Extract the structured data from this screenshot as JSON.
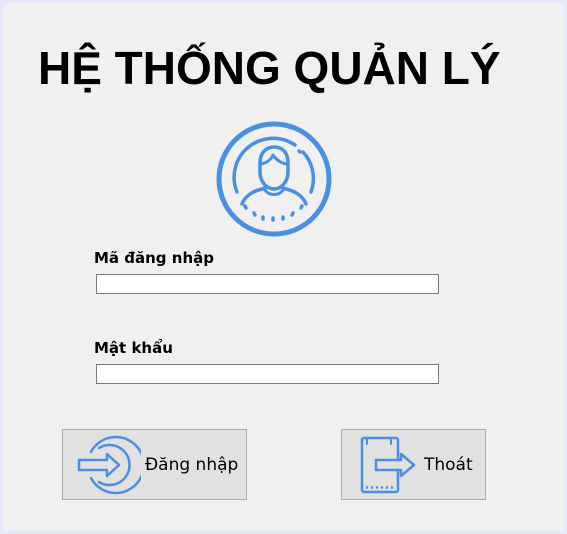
{
  "header": {
    "title": "HỆ THỐNG QUẢN LÝ"
  },
  "avatar": {
    "icon": "user-avatar-icon",
    "color": "#4a90e2"
  },
  "form": {
    "username_label": "Mã đăng nhập",
    "username_value": "",
    "password_label": "Mật khẩu",
    "password_value": ""
  },
  "buttons": {
    "login": {
      "label": "Đăng nhập",
      "icon": "sign-in-icon"
    },
    "exit": {
      "label": "Thoát",
      "icon": "exit-door-icon"
    }
  },
  "colors": {
    "accent": "#4a90e2",
    "window_bg": "#f0f0f0",
    "button_bg": "#e1e1e1",
    "frame_bg": "#e6e8f8"
  }
}
